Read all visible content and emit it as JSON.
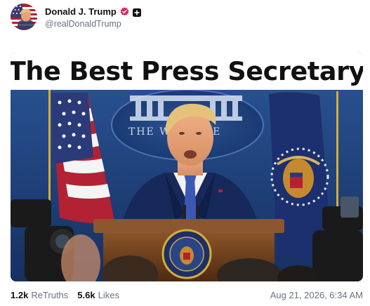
{
  "author": {
    "display_name": "Donald J. Trump",
    "handle": "@realDonaldTrump",
    "avatar_icon": "flag-portrait-avatar",
    "verified_icon": "verified-badge-icon",
    "verified_color": "#e0245e",
    "follow_icon": "plus-icon"
  },
  "media": {
    "headline": "The Best Press Secretary",
    "backdrop_text": "THE W      HOUSE",
    "colors": {
      "backdrop": "#1d3d73",
      "suit": "#17295a",
      "podium": "#6b3d1e"
    }
  },
  "stats": {
    "retruths_count": "1.2k",
    "retruths_label": "ReTruths",
    "likes_count": "5.6k",
    "likes_label": "Likes"
  },
  "timestamp": "Aug 21, 2026, 6:34 AM"
}
